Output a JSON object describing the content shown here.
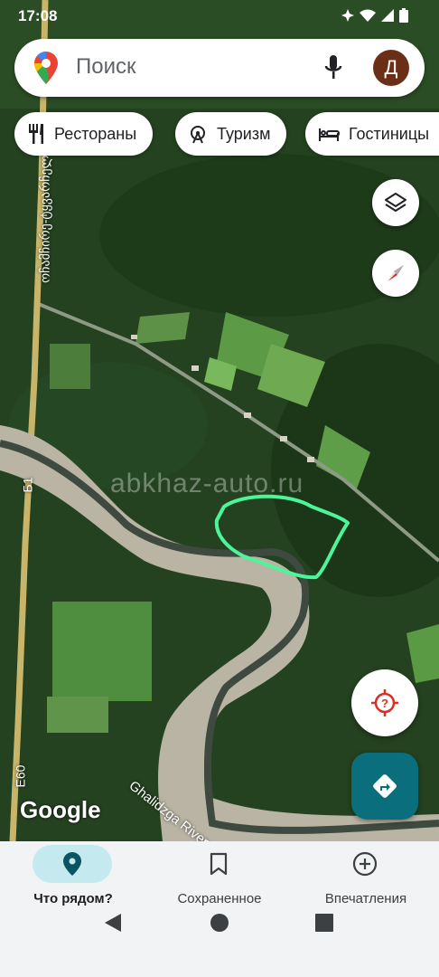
{
  "status_bar": {
    "time": "17:08"
  },
  "search": {
    "placeholder": "Поиск",
    "avatar_letter": "Д"
  },
  "chips": [
    {
      "label": "Рестораны",
      "icon": "fork-knife-icon"
    },
    {
      "label": "Туризм",
      "icon": "ferris-wheel-icon"
    },
    {
      "label": "Гостиницы",
      "icon": "bed-icon"
    }
  ],
  "map": {
    "watermark": "abkhaz-auto.ru",
    "river_label": "Ghalidzga River",
    "road_label_1": "E60",
    "road_label_2": "Б1",
    "road_label_vertical": "ოჩამჩირე-ტყვარჩელი",
    "attribution": "Google",
    "highlight_color": "#4cf59a"
  },
  "bottom_nav": {
    "tabs": [
      {
        "label": "Что рядом?",
        "icon": "location-pin-icon",
        "active": true
      },
      {
        "label": "Сохраненное",
        "icon": "bookmark-icon",
        "active": false
      },
      {
        "label": "Впечатления",
        "icon": "add-circle-icon",
        "active": false
      }
    ]
  }
}
